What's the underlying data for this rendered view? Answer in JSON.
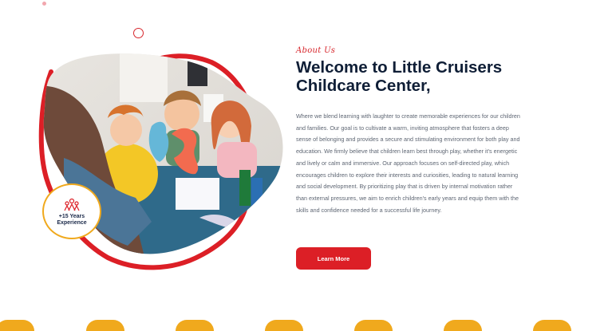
{
  "about": {
    "eyebrow": "About Us",
    "title_line1": "Welcome to Little Cruisers",
    "title_line2": "Childcare Center,",
    "body": "Where we blend learning with laughter to create memorable experiences for our children and families. Our goal is to cultivate a warm, inviting atmosphere that fosters a deep sense of belonging and provides a secure and stimulating environment for both play and education. We firmly believe that children learn best through play, whether it's energetic and lively or calm and immersive. Our approach focuses on self-directed play, which encourages children to explore their interests and curiosities, leading to natural learning and social development. By prioritizing play that is driven by internal motivation rather than external pressures, we aim to enrich children's early years and equip them with the skills and confidence needed for a successful life journey.",
    "cta_label": "Learn More"
  },
  "badge": {
    "line1": "+15 Years",
    "line2": "Experience",
    "icon": "children-group-icon"
  },
  "photo": {
    "description_icon": "children-playing-photo"
  },
  "colors": {
    "accent_red": "#dc1f26",
    "badge_gold": "#f0a91d",
    "title_navy": "#0f1e36",
    "body_gray": "#5e6673"
  }
}
